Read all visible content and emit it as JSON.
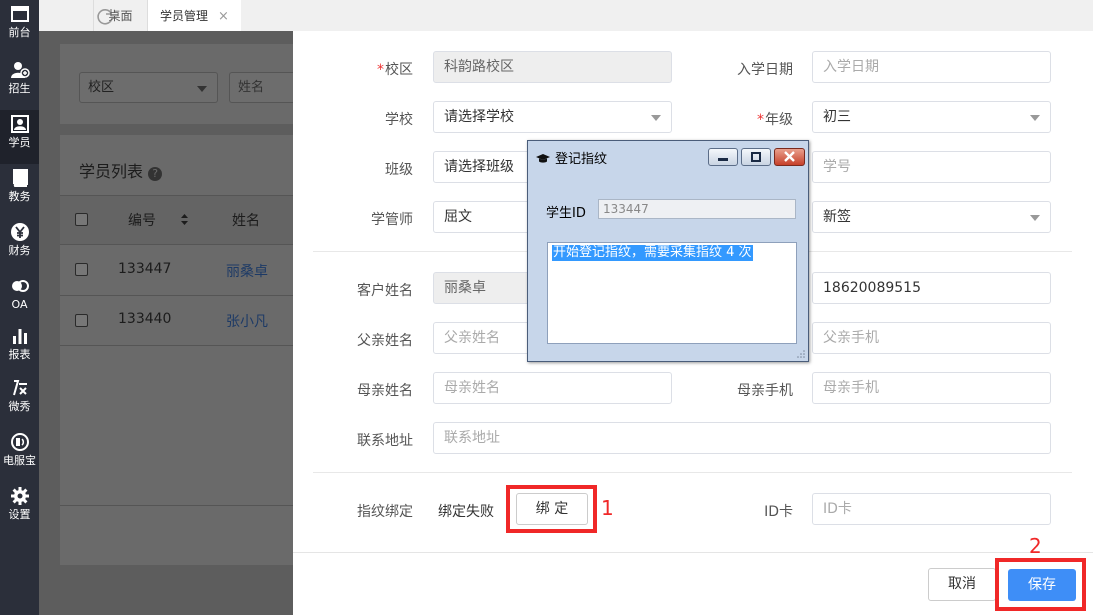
{
  "sidebar": {
    "items": [
      {
        "label": "前台",
        "icon": "window-icon"
      },
      {
        "label": "招生",
        "icon": "add-user-icon"
      },
      {
        "label": "学员",
        "icon": "user-card-icon"
      },
      {
        "label": "教务",
        "icon": "book-icon"
      },
      {
        "label": "财务",
        "icon": "yen-icon"
      },
      {
        "label": "OA",
        "icon": "oa-icon"
      },
      {
        "label": "报表",
        "icon": "bar-chart-icon"
      },
      {
        "label": "微秀",
        "icon": "xiu-icon"
      },
      {
        "label": "电服宝",
        "icon": "phone-service-icon"
      },
      {
        "label": "设置",
        "icon": "gear-icon"
      }
    ]
  },
  "tabs": [
    {
      "label": "桌面"
    },
    {
      "label": "学员管理",
      "close": "×"
    }
  ],
  "background": {
    "filter_campus": "校区",
    "filter_name_placeholder": "姓名",
    "list_title": "学员列表",
    "columns": [
      "编号",
      "姓名"
    ],
    "rows": [
      {
        "id": "133447",
        "name": "丽桑卓"
      },
      {
        "id": "133440",
        "name": "张小凡"
      }
    ]
  },
  "form": {
    "campus_label": "校区",
    "campus_value": "科韵路校区",
    "enroll_date_label": "入学日期",
    "enroll_date_placeholder": "入学日期",
    "school_label": "学校",
    "school_value": "请选择学校",
    "grade_label": "年级",
    "grade_value": "初三",
    "class_label": "班级",
    "class_value": "请选择班级",
    "student_no_placeholder": "学号",
    "manager_label": "学管师",
    "manager_value": "屈文",
    "status_value": "新签",
    "customer_label": "客户姓名",
    "customer_value": "丽桑卓",
    "phone_value": "18620089515",
    "father_name_label": "父亲姓名",
    "father_name_placeholder": "父亲姓名",
    "father_phone_placeholder": "父亲手机",
    "mother_name_label": "母亲姓名",
    "mother_name_placeholder": "母亲姓名",
    "mother_phone_label": "母亲手机",
    "mother_phone_placeholder": "母亲手机",
    "address_label": "联系地址",
    "address_placeholder": "联系地址",
    "fingerprint_label": "指纹绑定",
    "fingerprint_status": "绑定失败",
    "bind_button": "绑 定",
    "idcard_label": "ID卡",
    "idcard_placeholder": "ID卡",
    "required_mark": "*"
  },
  "annotations": {
    "mark1": "1",
    "mark2": "2"
  },
  "footer": {
    "cancel": "取消",
    "save": "保存"
  },
  "dialog": {
    "title": "登记指纹",
    "student_id_label": "学生ID",
    "student_id_value": "133447",
    "message": "开始登记指纹，需要采集指纹 4 次"
  },
  "colors": {
    "accent": "#3e8ef7",
    "annotation": "#f02828",
    "sidebar": "#2b2f3a"
  }
}
